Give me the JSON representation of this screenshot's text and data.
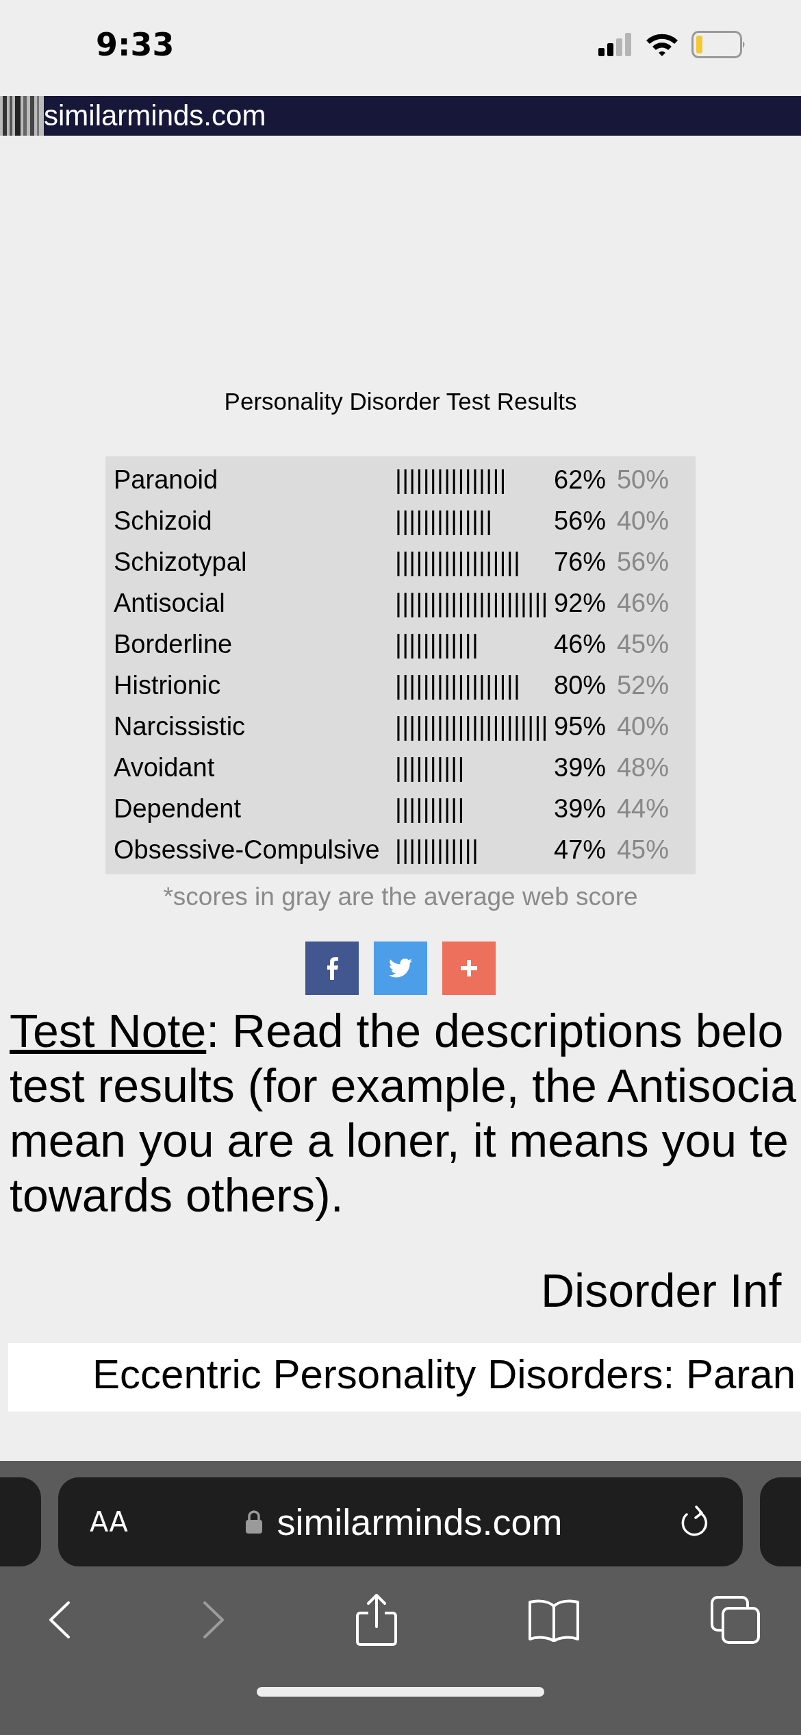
{
  "status_bar": {
    "time": "9:33"
  },
  "site_header": {
    "title": "similarminds.com"
  },
  "results": {
    "title": "Personality Disorder Test Results",
    "rows": [
      {
        "name": "Paranoid",
        "bar": "||||||||||||||||",
        "score": "62%",
        "average": "50%"
      },
      {
        "name": "Schizoid",
        "bar": "||||||||||||||",
        "score": "56%",
        "average": "40%"
      },
      {
        "name": "Schizotypal",
        "bar": "||||||||||||||||||",
        "score": "76%",
        "average": "56%"
      },
      {
        "name": "Antisocial",
        "bar": "||||||||||||||||||||||",
        "score": "92%",
        "average": "46%"
      },
      {
        "name": "Borderline",
        "bar": "||||||||||||",
        "score": "46%",
        "average": "45%"
      },
      {
        "name": "Histrionic",
        "bar": "||||||||||||||||||",
        "score": "80%",
        "average": "52%"
      },
      {
        "name": "Narcissistic",
        "bar": "||||||||||||||||||||||",
        "score": "95%",
        "average": "40%"
      },
      {
        "name": "Avoidant",
        "bar": "||||||||||",
        "score": "39%",
        "average": "48%"
      },
      {
        "name": "Dependent",
        "bar": "||||||||||",
        "score": "39%",
        "average": "44%"
      },
      {
        "name": "Obsessive-Compulsive",
        "bar": "||||||||||||",
        "score": "47%",
        "average": "45%"
      }
    ],
    "footnote": "*scores in gray are the average web score"
  },
  "share_buttons": [
    {
      "kind": "facebook",
      "color": "#42578f"
    },
    {
      "kind": "twitter",
      "color": "#4c9ee8"
    },
    {
      "kind": "plus",
      "color": "#ec705b"
    }
  ],
  "test_note": {
    "heading": "Test Note",
    "lines": [
      ": Read the descriptions belo",
      "test results (for example, the Antisocia",
      "mean you are a loner, it means you te",
      "towards others)."
    ]
  },
  "section_heading": "Disorder Inf",
  "section_band": "Eccentric Personality Disorders: Paran",
  "browser": {
    "text_size": "AA",
    "url": "similarminds.com"
  }
}
